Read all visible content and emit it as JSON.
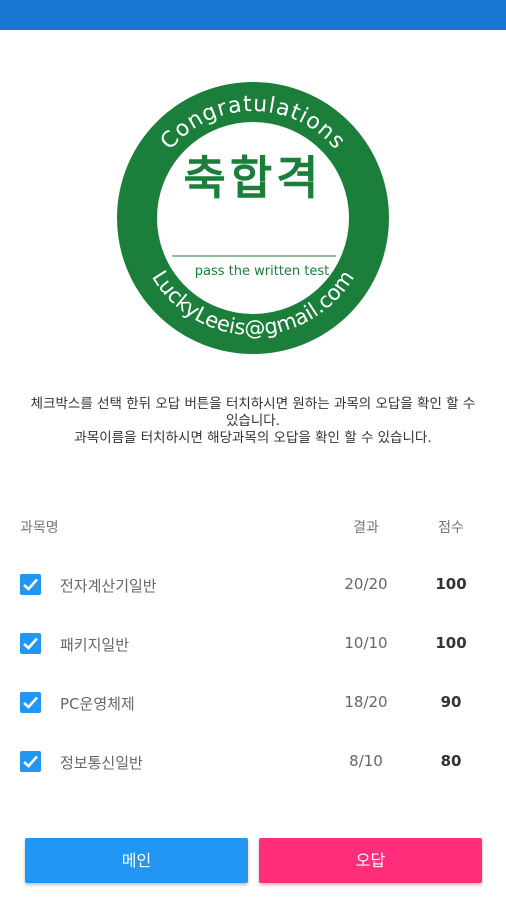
{
  "seal": {
    "top_text": "Congratulations",
    "center_text": "축합격",
    "sub_text": "pass the written test",
    "bottom_text": "LuckyLeeis@gmail.com"
  },
  "instructions": {
    "line1": "체크박스를 선택 한뒤 오답 버튼을 터치하시면 원하는 과목의 오답을 확인 할 수 있습니다.",
    "line2": "과목이름을 터치하시면 해당과목의 오답을 확인 할 수 있습니다."
  },
  "table": {
    "headers": {
      "name": "과목명",
      "result": "결과",
      "score": "점수"
    },
    "rows": [
      {
        "subject": "전자계산기일반",
        "result": "20/20",
        "score": "100",
        "checked": true
      },
      {
        "subject": "패키지일반",
        "result": "10/10",
        "score": "100",
        "checked": true
      },
      {
        "subject": "PC운영체제",
        "result": "18/20",
        "score": "90",
        "checked": true
      },
      {
        "subject": "정보통신일반",
        "result": "8/10",
        "score": "80",
        "checked": true
      }
    ]
  },
  "buttons": {
    "main": "메인",
    "wrong": "오답"
  },
  "colors": {
    "appbar": "#1976d2",
    "seal": "#1b7f3b",
    "primary": "#2196f3",
    "accent": "#ff2d7a"
  }
}
